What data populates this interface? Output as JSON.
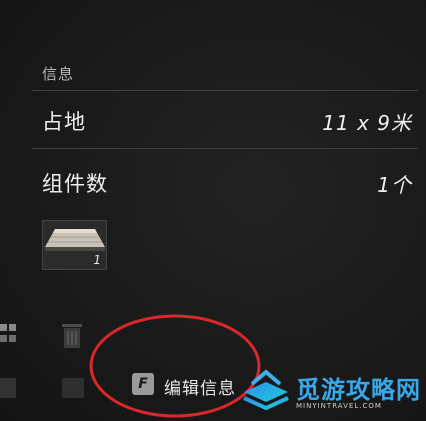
{
  "info": {
    "section_title": "信息",
    "footprint": {
      "label": "占地",
      "value": "11 x 9米"
    },
    "component_count": {
      "label": "组件数",
      "value": "1个"
    },
    "component_item": {
      "icon": "wooden-plank-icon",
      "count": "1"
    }
  },
  "sidebar_icons": [
    "grid-icon",
    "trash-icon",
    "box-icon"
  ],
  "action": {
    "key": "F",
    "label": "编辑信息"
  },
  "annotation": {
    "color": "#d8282a"
  },
  "watermark": {
    "text": "觅游攻略网",
    "subtext": "MINYINTRAVEL.COM",
    "color": "#39a8ea"
  }
}
